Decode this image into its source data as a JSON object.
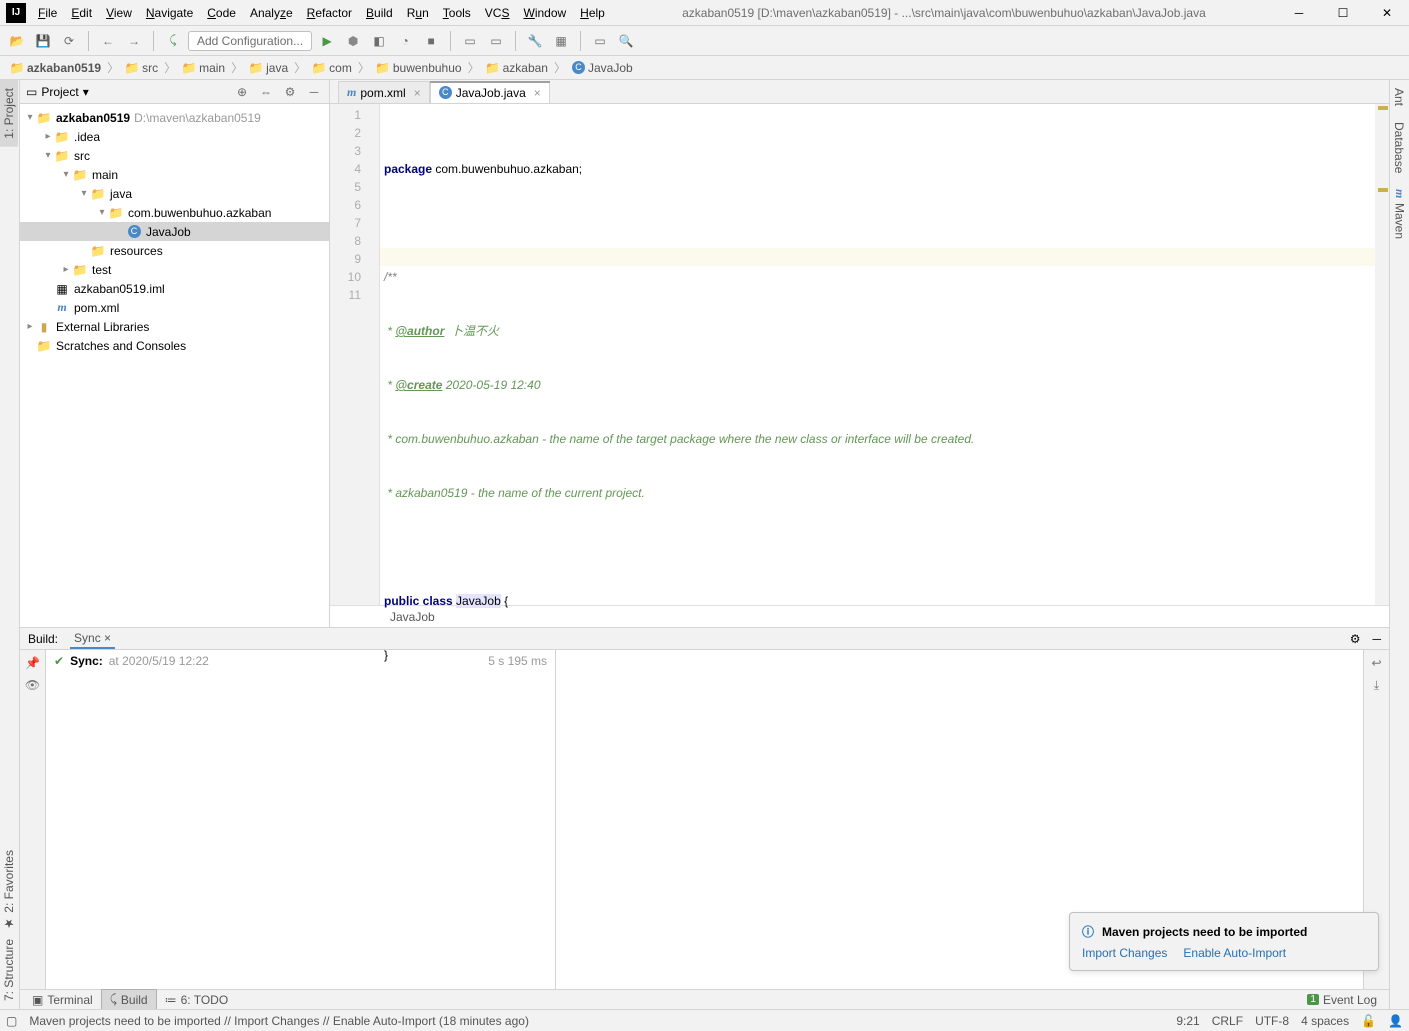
{
  "window_title": "azkaban0519 [D:\\maven\\azkaban0519] - ...\\src\\main\\java\\com\\buwenbuhuo\\azkaban\\JavaJob.java",
  "menu": [
    "File",
    "Edit",
    "View",
    "Navigate",
    "Code",
    "Analyze",
    "Refactor",
    "Build",
    "Run",
    "Tools",
    "VCS",
    "Window",
    "Help"
  ],
  "toolbar": {
    "config_label": "Add Configuration..."
  },
  "breadcrumb": [
    "azkaban0519",
    "src",
    "main",
    "java",
    "com",
    "buwenbuhuo",
    "azkaban",
    "JavaJob"
  ],
  "left_tabs": {
    "project": "1: Project",
    "favorites": "2: Favorites",
    "structure": "7: Structure"
  },
  "right_tabs": {
    "ant": "Ant",
    "database": "Database",
    "maven": "Maven"
  },
  "project": {
    "header": "Project",
    "root_name": "azkaban0519",
    "root_path": "D:\\maven\\azkaban0519",
    "idea": ".idea",
    "src": "src",
    "main": "main",
    "java": "java",
    "pkg": "com.buwenbuhuo.azkaban",
    "javajob": "JavaJob",
    "resources": "resources",
    "test": "test",
    "iml": "azkaban0519.iml",
    "pom": "pom.xml",
    "ext": "External Libraries",
    "scratches": "Scratches and Consoles"
  },
  "tabs": {
    "pom": "pom.xml",
    "javajob": "JavaJob.java"
  },
  "code": {
    "l1_pkg": "package",
    "l1_rest": " com.buwenbuhuo.azkaban;",
    "l3": "/**",
    "l4_star": " * ",
    "l4_tag": "@author",
    "l4_rest": "  卜温不火",
    "l5_star": " * ",
    "l5_tag": "@create",
    "l5_rest": " 2020-05-19 12:40",
    "l6": " * com.buwenbuhuo.azkaban - the name of the target package where the new class or interface will be created.",
    "l7": " * azkaban0519 - the name of the current project.",
    "l9_pub": "public",
    "l9_cls": " class ",
    "l9_name": "JavaJob",
    "l9_brace": " {",
    "l10": "}",
    "bread": "JavaJob"
  },
  "build": {
    "label": "Build:",
    "sync_tab": "Sync",
    "sync_line": "Sync:",
    "sync_time": "at 2020/5/19 12:22",
    "duration": "5 s 195 ms"
  },
  "bottom_tabs": {
    "terminal": "Terminal",
    "build": "Build",
    "todo": "6: TODO",
    "eventlog": "Event Log"
  },
  "status": {
    "msg": "Maven projects need to be imported // Import Changes // Enable Auto-Import (18 minutes ago)",
    "pos": "9:21",
    "eol": "CRLF",
    "enc": "UTF-8",
    "indent": "4 spaces"
  },
  "notif": {
    "title": "Maven projects need to be imported",
    "link1": "Import Changes",
    "link2": "Enable Auto-Import"
  }
}
